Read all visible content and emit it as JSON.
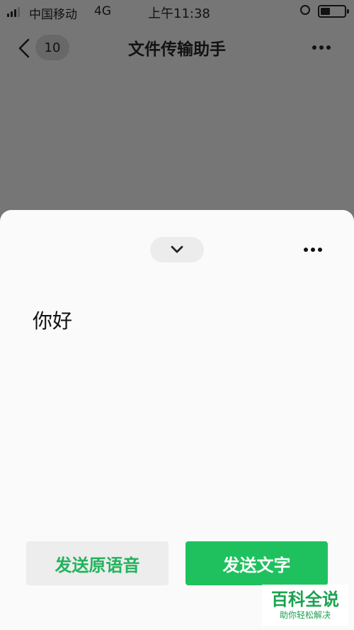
{
  "status_bar": {
    "carrier": "中国移动",
    "network": "4G",
    "time": "上午11:38"
  },
  "nav": {
    "unread_count": "10",
    "title": "文件传输助手"
  },
  "sheet": {
    "transcript": "你好",
    "send_voice_label": "发送原语音",
    "send_text_label": "发送文字"
  },
  "watermark": {
    "main": "百科全说",
    "sub": "助你轻松解决"
  },
  "colors": {
    "accent_green": "#1fc15e",
    "overlay_gray": "#767676"
  }
}
